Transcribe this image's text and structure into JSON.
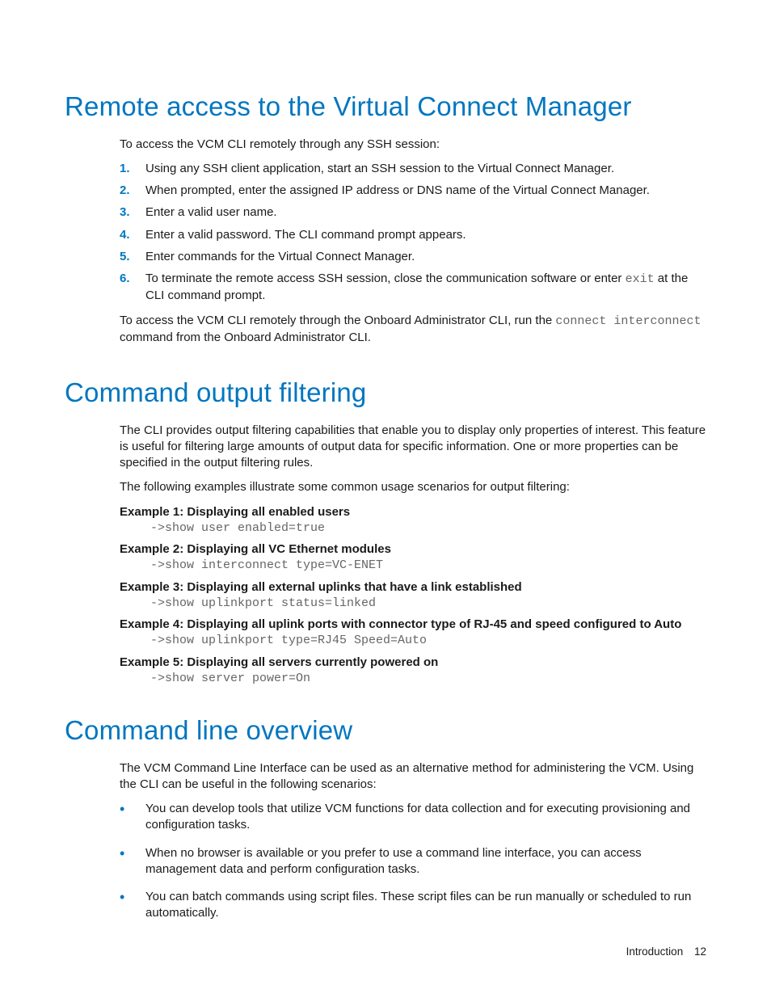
{
  "section1": {
    "heading": "Remote access to the Virtual Connect Manager",
    "intro": "To access the VCM CLI remotely through any SSH session:",
    "steps": [
      "Using any SSH client application, start an SSH session to the Virtual Connect Manager.",
      "When prompted, enter the assigned IP address or DNS name of the Virtual Connect Manager.",
      "Enter a valid user name.",
      "Enter a valid password. The CLI command prompt appears.",
      "Enter commands for the Virtual Connect Manager.",
      "To terminate the remote access SSH session, close the communication software or enter <mono>exit</mono> at the CLI command prompt."
    ],
    "post": "To access the VCM CLI remotely through the Onboard Administrator CLI, run the <mono>connect interconnect</mono> command from the Onboard Administrator CLI."
  },
  "section2": {
    "heading": "Command output filtering",
    "para1": "The CLI provides output filtering capabilities that enable you to display only properties of interest. This feature is useful for filtering large amounts of output data for specific information. One or more properties can be specified in the output filtering rules.",
    "para2": "The following examples illustrate some common usage scenarios for output filtering:",
    "examples": [
      {
        "title": "Example 1: Displaying all enabled users",
        "code": "->show user enabled=true"
      },
      {
        "title": "Example 2: Displaying all VC Ethernet modules",
        "code": "->show interconnect type=VC-ENET"
      },
      {
        "title": "Example 3: Displaying all external uplinks that have a link established",
        "code": "->show uplinkport status=linked"
      },
      {
        "title": "Example 4: Displaying all uplink ports with connector type of RJ-45 and speed configured to Auto",
        "code": "->show uplinkport type=RJ45 Speed=Auto"
      },
      {
        "title": "Example 5: Displaying all servers currently powered on",
        "code": "->show server power=On"
      }
    ]
  },
  "section3": {
    "heading": "Command line overview",
    "intro": "The VCM Command Line Interface can be used as an alternative method for administering the VCM. Using the CLI can be useful in the following scenarios:",
    "bullets": [
      "You can develop tools that utilize VCM functions for data collection and for executing provisioning and configuration tasks.",
      "When no browser is available or you prefer to use a command line interface, you can access management data and perform configuration tasks.",
      "You can batch commands using script files. These script files can be run manually or scheduled to run automatically."
    ]
  },
  "footer": {
    "section": "Introduction",
    "page": "12"
  }
}
